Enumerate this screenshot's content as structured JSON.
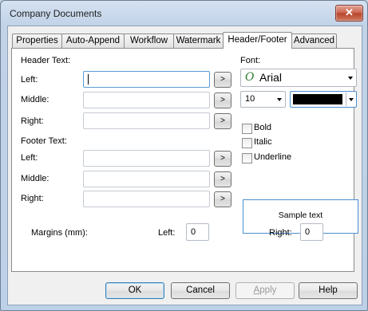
{
  "window": {
    "title": "Company Documents",
    "close_glyph": "✕"
  },
  "tabs": [
    "Properties",
    "Auto-Append",
    "Workflow",
    "Watermark",
    "Header/Footer",
    "Advanced"
  ],
  "header": {
    "section": "Header Text:",
    "left_label": "Left:",
    "middle_label": "Middle:",
    "right_label": "Right:",
    "left_value": "",
    "middle_value": "",
    "right_value": ""
  },
  "footer": {
    "section": "Footer Text:",
    "left_label": "Left:",
    "middle_label": "Middle:",
    "right_label": "Right:",
    "left_value": "",
    "middle_value": "",
    "right_value": ""
  },
  "arrow_label": ">",
  "font": {
    "label": "Font:",
    "glyph": "O",
    "name": "Arial",
    "size": "10",
    "color": "#000000",
    "bold": "Bold",
    "italic": "Italic",
    "underline": "Underline",
    "bold_checked": false,
    "italic_checked": false,
    "underline_checked": false,
    "sample": "Sample text"
  },
  "margins": {
    "label": "Margins (mm):",
    "left_label": "Left:",
    "left_value": "0",
    "right_label": "Right:",
    "right_value": "0"
  },
  "buttons": {
    "ok": "OK",
    "cancel": "Cancel",
    "apply": "Apply",
    "help": "Help"
  }
}
